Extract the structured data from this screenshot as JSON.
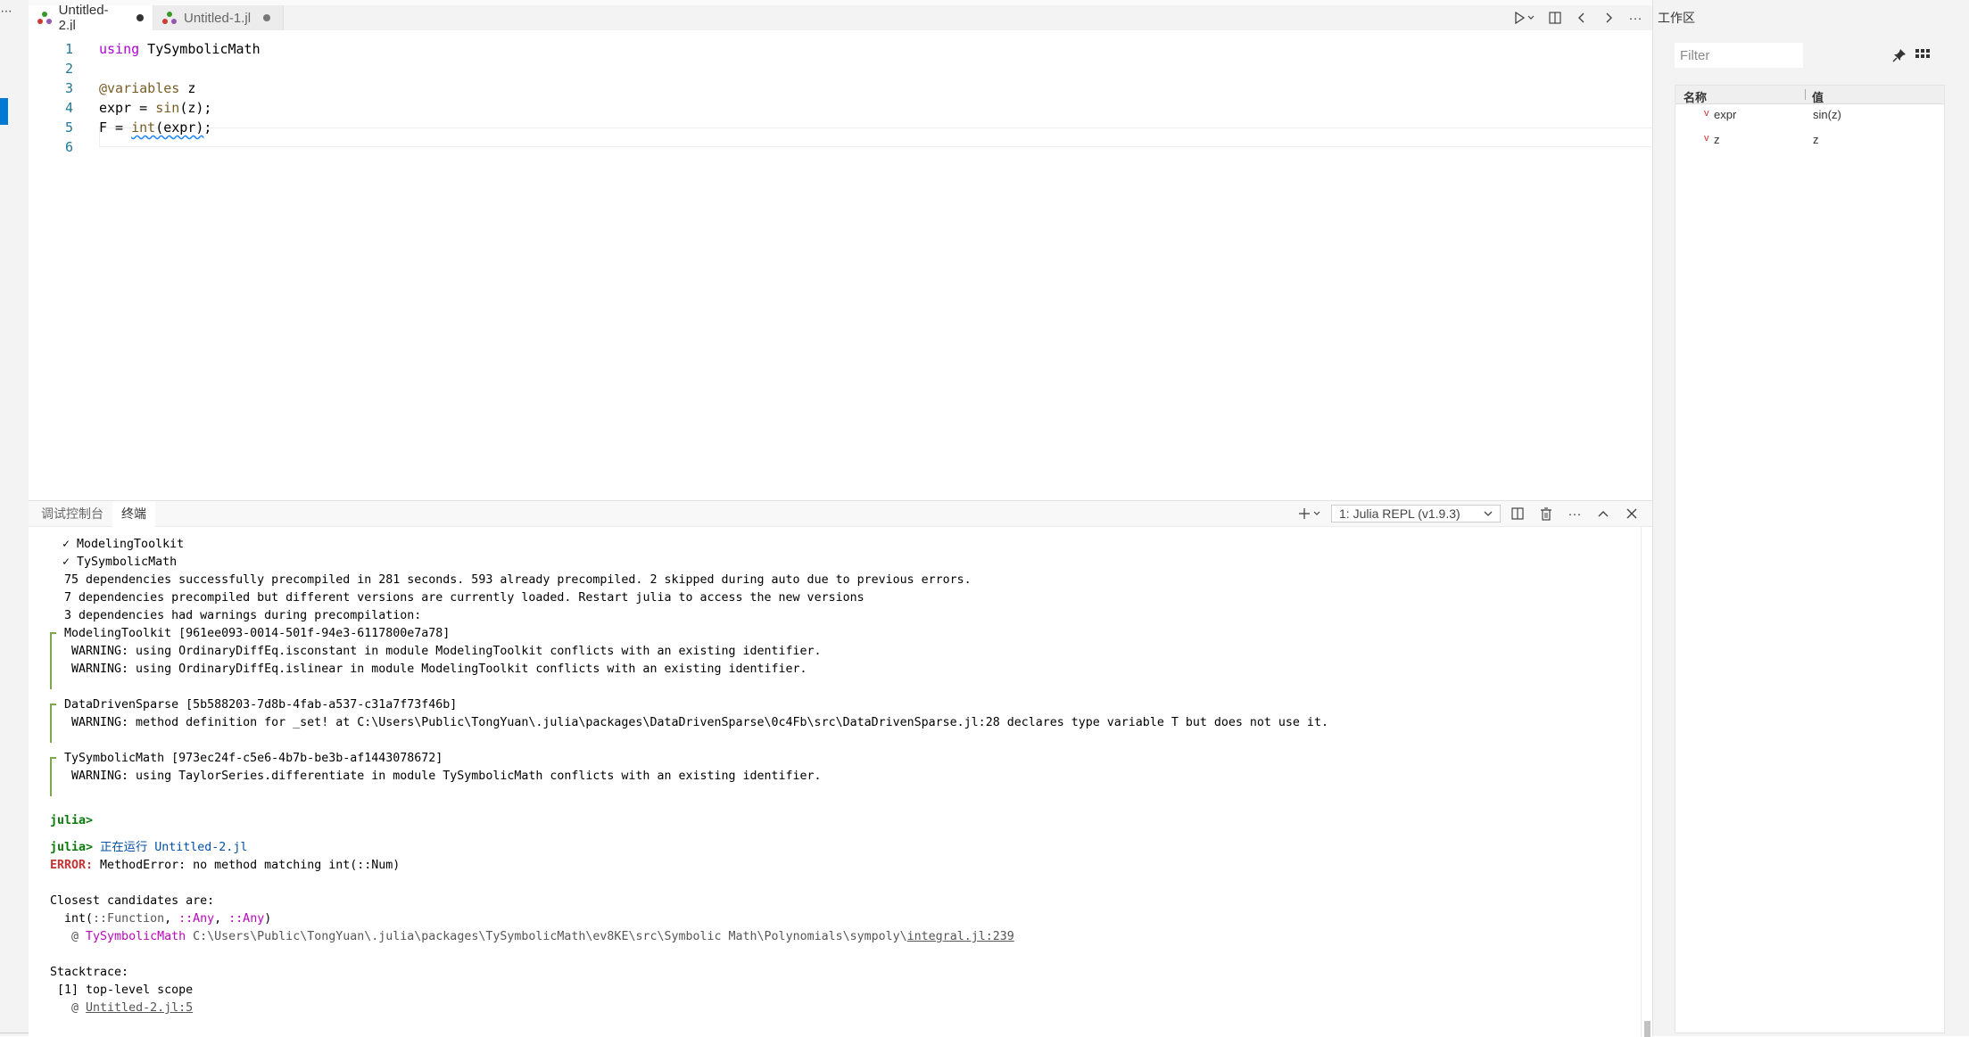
{
  "tabs": [
    {
      "label": "Untitled-2.jl",
      "active": true,
      "dirty": true
    },
    {
      "label": "Untitled-1.jl",
      "active": false,
      "dirty": true
    }
  ],
  "editor": {
    "line_numbers": [
      "1",
      "2",
      "3",
      "4",
      "5",
      "6"
    ],
    "code": {
      "l1_kw": "using",
      "l1_rest": " TySymbolicMath",
      "l3_macro": "@variables",
      "l3_rest": " z",
      "l4_a": "expr = ",
      "l4_fn": "sin",
      "l4_b": "(z);",
      "l5_a": "F = ",
      "l5_fn": "int",
      "l5_b": "(expr)",
      "l5_c": ";"
    }
  },
  "panel": {
    "tabs": [
      "调试控制台",
      "终端"
    ],
    "terminal_select": "1: Julia REPL (v1.9.3)"
  },
  "terminal": {
    "check1": "✓ ModelingToolkit",
    "check2": "✓ TySymbolicMath",
    "summary1": "75 dependencies successfully precompiled in 281 seconds. 593 already precompiled. 2 skipped during auto due to previous errors.",
    "summary2": "7 dependencies precompiled but different versions are currently loaded. Restart julia to access the new versions",
    "summary3": "3 dependencies had warnings during precompilation:",
    "mt_header": "ModelingToolkit [961ee093-0014-501f-94e3-6117800e7a78]",
    "mt_warn1": "WARNING: using OrdinaryDiffEq.isconstant in module ModelingToolkit conflicts with an existing identifier.",
    "mt_warn2": "WARNING: using OrdinaryDiffEq.islinear in module ModelingToolkit conflicts with an existing identifier.",
    "dds_header": "DataDrivenSparse [5b588203-7d8b-4fab-a537-c31a7f73f46b]",
    "dds_warn": "WARNING: method definition for _set! at C:\\Users\\Public\\TongYuan\\.julia\\packages\\DataDrivenSparse\\0c4Fb\\src\\DataDrivenSparse.jl:28 declares type variable T but does not use it.",
    "tsm_header": "TySymbolicMath [973ec24f-c5e6-4b7b-be3b-af1443078672]",
    "tsm_warn": "WARNING: using TaylorSeries.differentiate in module TySymbolicMath conflicts with an existing identifier.",
    "prompt": "julia>",
    "running_label": "正在运行 Untitled-2.jl",
    "error_label": "ERROR:",
    "error_msg": " MethodError: no method matching int(::Num)",
    "closest": "Closest candidates are:",
    "cand_a": "  int(",
    "cand_b": "::Function",
    "cand_c": ", ",
    "cand_d": "::Any",
    "cand_e": ", ",
    "cand_f": "::Any",
    "cand_g": ")",
    "at1_prefix": "   @ ",
    "at1_module": "TySymbolicMath",
    "at1_path": " C:\\Users\\Public\\TongYuan\\.julia\\packages\\TySymbolicMath\\ev8KE\\src\\Symbolic Math\\Polynomials\\sympoly\\",
    "at1_file": "integral.jl:239",
    "stacktrace": "Stacktrace:",
    "frame1": " [1] top-level scope",
    "at2_prefix": "   @ ",
    "at2_file": "Untitled-2.jl:5"
  },
  "workspace": {
    "title": "工作区",
    "filter_placeholder": "Filter",
    "col_name": "名称",
    "col_value": "值",
    "rows": [
      {
        "name": "expr",
        "value": "sin(z)"
      },
      {
        "name": "z",
        "value": "z"
      }
    ]
  },
  "colors": {
    "accent": "#0078d4",
    "error": "#cd3131",
    "prompt": "#0b7a0b",
    "keyword": "#af00db"
  }
}
